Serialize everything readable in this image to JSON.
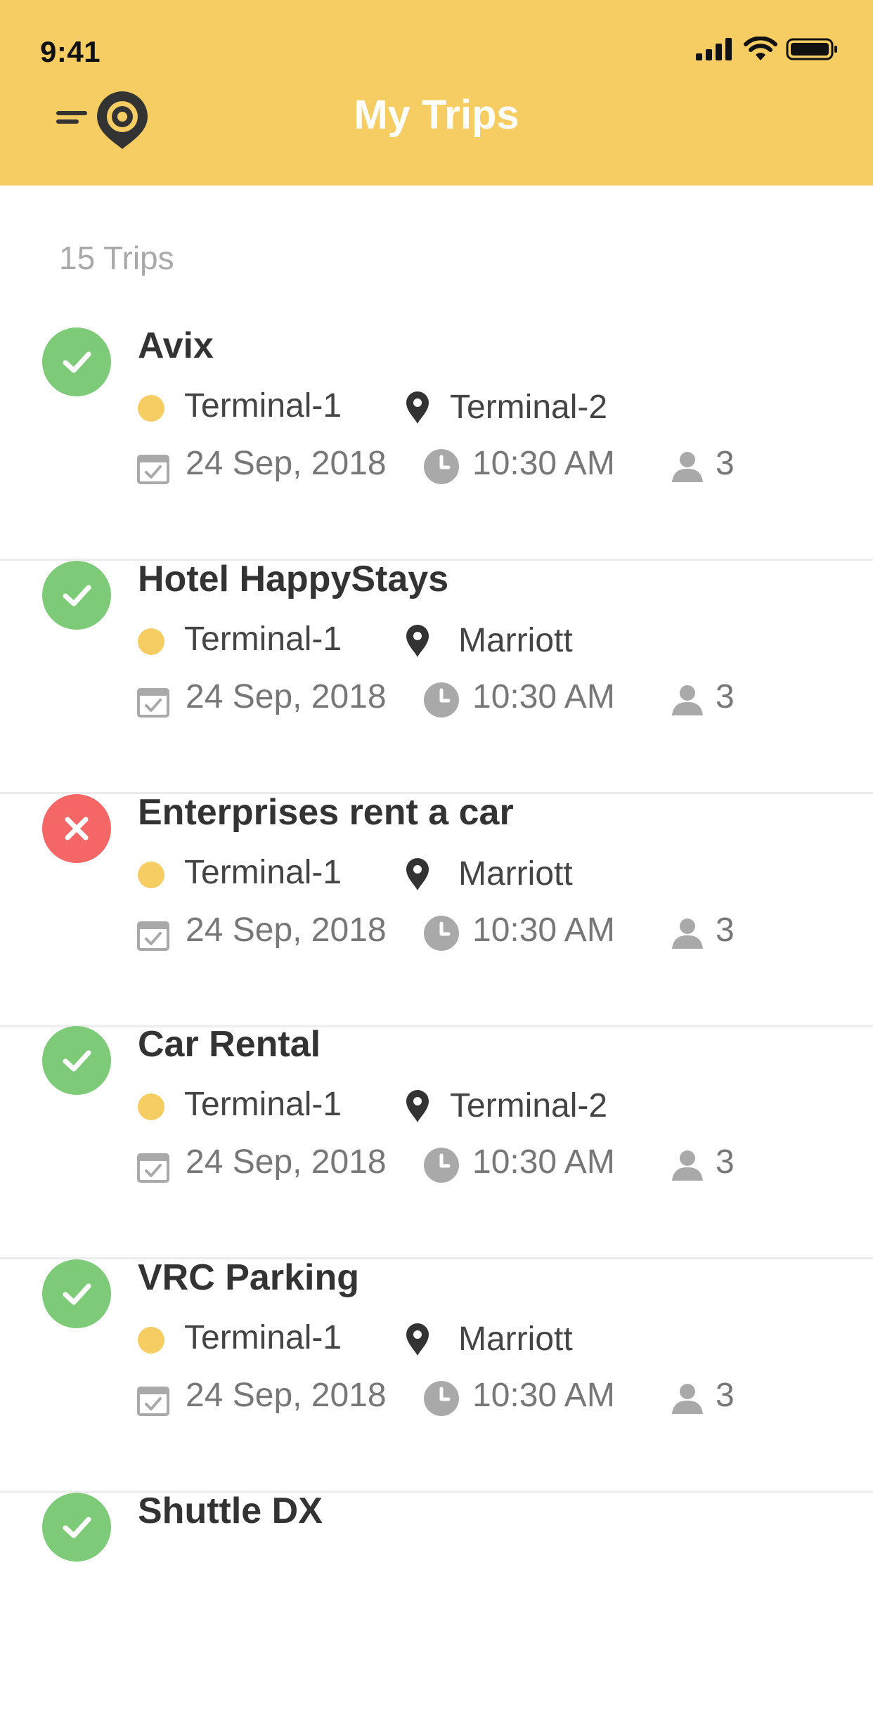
{
  "status_bar": {
    "time": "9:41"
  },
  "header": {
    "title": "My Trips"
  },
  "trips_count": "15 Trips",
  "trips": [
    {
      "name": "Avix",
      "status": "completed",
      "from": "Terminal-1",
      "to": "Terminal-2",
      "date": "24 Sep, 2018",
      "time": "10:30 AM",
      "passengers": "3"
    },
    {
      "name": "Hotel HappyStays",
      "status": "completed",
      "from": "Terminal-1",
      "to": "Marriott",
      "date": "24 Sep, 2018",
      "time": "10:30 AM",
      "passengers": "3"
    },
    {
      "name": "Enterprises rent a car",
      "status": "cancelled",
      "from": "Terminal-1",
      "to": "Marriott",
      "date": "24 Sep, 2018",
      "time": "10:30 AM",
      "passengers": "3"
    },
    {
      "name": "Car Rental",
      "status": "completed",
      "from": "Terminal-1",
      "to": "Terminal-2",
      "date": "24 Sep, 2018",
      "time": "10:30 AM",
      "passengers": "3"
    },
    {
      "name": "VRC Parking",
      "status": "completed",
      "from": "Terminal-1",
      "to": "Marriott",
      "date": "24 Sep, 2018",
      "time": "10:30 AM",
      "passengers": "3"
    },
    {
      "name": "Shuttle DX",
      "status": "completed"
    }
  ],
  "icons": {
    "menu": "menu-icon",
    "logo": "location-logo-icon",
    "check": "check-icon",
    "cancel": "close-icon",
    "origin": "origin-dot-icon",
    "destination": "map-pin-icon",
    "date": "calendar-icon",
    "time": "clock-icon",
    "passengers": "person-icon"
  },
  "colors": {
    "header": "#F5CD62",
    "completed": "#7DCA78",
    "cancelled": "#F56666",
    "origin_dot": "#F5CD62"
  }
}
